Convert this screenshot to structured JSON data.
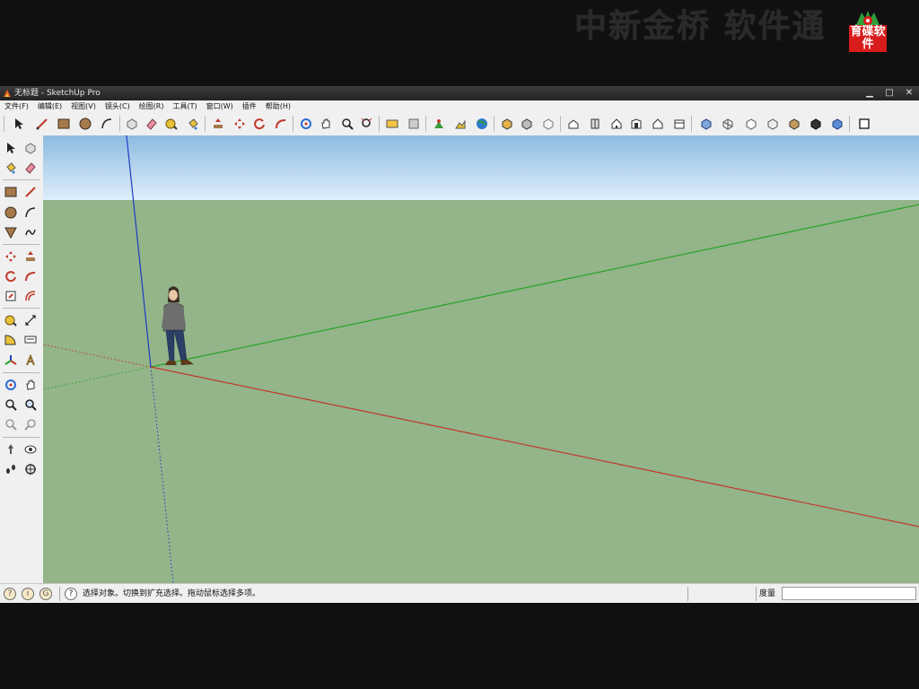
{
  "watermark": {
    "text": "中新金桥 软件通",
    "logo_text": "育碟软件"
  },
  "window": {
    "title": "无标题 - SketchUp Pro",
    "controls": {
      "minimize": "▁",
      "maximize": "□",
      "close": "✕"
    }
  },
  "menu": {
    "items": [
      {
        "label": "文件(F)"
      },
      {
        "label": "编辑(E)"
      },
      {
        "label": "视图(V)"
      },
      {
        "label": "镜头(C)"
      },
      {
        "label": "绘图(R)"
      },
      {
        "label": "工具(T)"
      },
      {
        "label": "窗口(W)"
      },
      {
        "label": "插件"
      },
      {
        "label": "帮助(H)"
      }
    ]
  },
  "status": {
    "hint": "选择对象。切换到扩充选择。拖动鼠标选择多项。",
    "measure_label": "度量",
    "measure_value": ""
  },
  "colors": {
    "sky_top": "#8dbbe0",
    "sky_bottom": "#dfeefa",
    "ground": "#94b48a",
    "axis_red": "#c0392b",
    "axis_green": "#27a327",
    "axis_blue": "#1f3cc4"
  }
}
